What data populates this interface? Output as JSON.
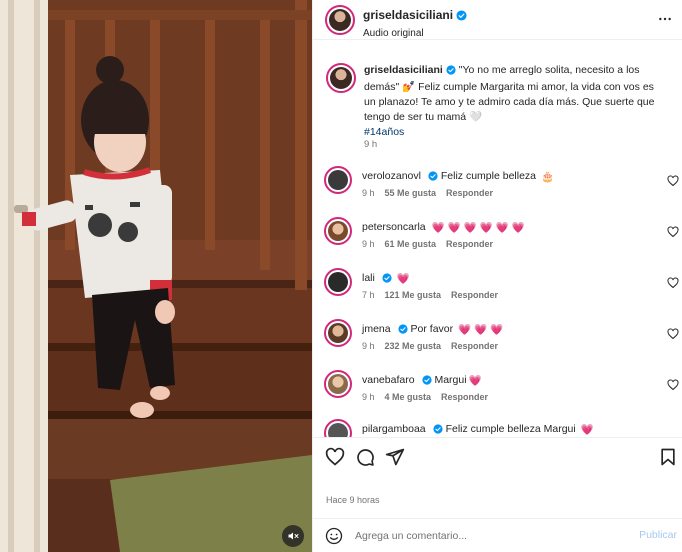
{
  "post": {
    "author": "griseldasiciliani",
    "audio": "Audio original",
    "more_icon": "more-horizontal-icon"
  },
  "caption": {
    "author": "griseldasiciliani",
    "text": " \"Yo no me arreglo solita, necesito a los demás\" 💅 Feliz cumple Margarita mi amor, la vida con vos es un planazo! Te amo y te admiro cada día más. Que suerte que tengo de ser tu mamá 🤍",
    "hashtag": "#14años",
    "time": "9 h"
  },
  "comments": [
    {
      "user": "verolozanovl",
      "text": "Feliz cumple belleza",
      "emoji": "🎂",
      "time": "9 h",
      "likes": "55 Me gusta",
      "reply": "Responder",
      "avatar_color": "#3a3a3a"
    },
    {
      "user": "petersoncarla",
      "text": "",
      "emoji": "💗 💗 💗 💗 💗 💗",
      "time": "9 h",
      "likes": "61 Me gusta",
      "reply": "Responder",
      "avatar_color": "#b57a55"
    },
    {
      "user": "lali",
      "text": "",
      "emoji": "💗",
      "time": "7 h",
      "likes": "121 Me gusta",
      "reply": "Responder",
      "avatar_color": "#2a2a2a"
    },
    {
      "user": "jmena",
      "text": "Por favor",
      "emoji": "💗 💗 💗",
      "time": "9 h",
      "likes": "232 Me gusta",
      "reply": "Responder",
      "avatar_color": "#8a5a3c"
    },
    {
      "user": "vanebafaro",
      "text": "Margui",
      "emoji": "💗",
      "time": "9 h",
      "likes": "4 Me gusta",
      "reply": "Responder",
      "avatar_color": "#c49a6c"
    },
    {
      "user": "pilargamboaa",
      "text": "Feliz cumple belleza Margui",
      "emoji": "💗",
      "time": "",
      "likes": "",
      "reply": "",
      "avatar_color": "#555555"
    }
  ],
  "footer": {
    "time_ago": "Hace 9 horas",
    "comment_placeholder": "Agrega un comentario...",
    "publish": "Publicar"
  },
  "colors": {
    "accent": "#0095f6",
    "verified": "#0095f6",
    "publish_disabled": "#a8c8f0",
    "story_ring": "#d0287a",
    "heart": "#ed4956"
  }
}
